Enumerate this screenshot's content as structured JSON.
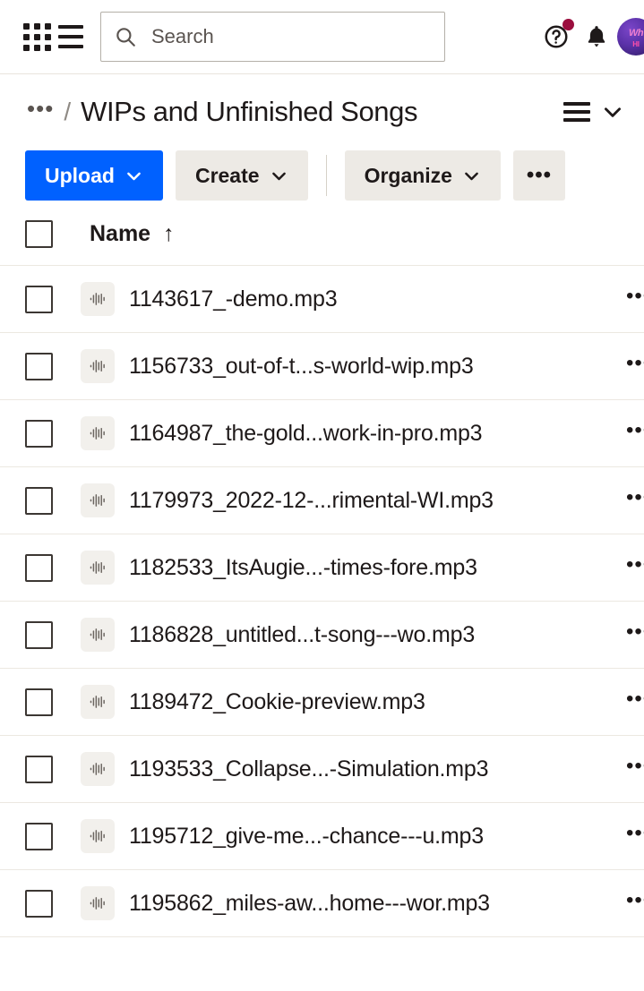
{
  "topbar": {
    "apps_icon": "grid-apps-icon",
    "menu_icon": "hamburger-menu-icon",
    "search": {
      "icon": "search-icon",
      "placeholder": "Search",
      "value": ""
    },
    "help_icon": "help-circle-icon",
    "help_badge": true,
    "notifications_icon": "bell-icon",
    "avatar": {
      "name": "user-avatar",
      "line1": "Wh",
      "line2": "HI"
    },
    "badge_color": "#9b0e3e"
  },
  "breadcrumb": {
    "overflow": "•••",
    "separator": "/",
    "title": "WIPs and Unfinished Songs",
    "view_icon": "list-view-icon",
    "view_chevron": "chevron-down-icon"
  },
  "toolbar": {
    "upload_label": "Upload",
    "create_label": "Create",
    "organize_label": "Organize",
    "more_label": "•••",
    "chevron": "chevron-down-icon",
    "primary_color": "#0061ff",
    "secondary_color": "#edeae5"
  },
  "table": {
    "select_all": "select-all-checkbox",
    "columns": [
      {
        "label": "Name",
        "sort": "↑",
        "sort_dir": "asc"
      }
    ],
    "row_menu": "•••",
    "rows": [
      {
        "name": "1143617_-demo.mp3",
        "icon": "audio-waveform-icon",
        "checked": false
      },
      {
        "name": "1156733_out-of-t...s-world-wip.mp3",
        "icon": "audio-waveform-icon",
        "checked": false
      },
      {
        "name": "1164987_the-gold...work-in-pro.mp3",
        "icon": "audio-waveform-icon",
        "checked": false
      },
      {
        "name": "1179973_2022-12-...rimental-WI.mp3",
        "icon": "audio-waveform-icon",
        "checked": false
      },
      {
        "name": "1182533_ItsAugie...-times-fore.mp3",
        "icon": "audio-waveform-icon",
        "checked": false
      },
      {
        "name": "1186828_untitled...t-song---wo.mp3",
        "icon": "audio-waveform-icon",
        "checked": false
      },
      {
        "name": "1189472_Cookie-preview.mp3",
        "icon": "audio-waveform-icon",
        "checked": false
      },
      {
        "name": "1193533_Collapse...-Simulation.mp3",
        "icon": "audio-waveform-icon",
        "checked": false
      },
      {
        "name": "1195712_give-me...-chance---u.mp3",
        "icon": "audio-waveform-icon",
        "checked": false
      },
      {
        "name": "1195862_miles-aw...home---wor.mp3",
        "icon": "audio-waveform-icon",
        "checked": false
      }
    ]
  }
}
